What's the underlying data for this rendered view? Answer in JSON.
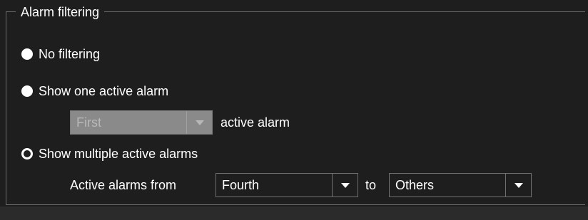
{
  "groupbox": {
    "title": "Alarm filtering"
  },
  "options": {
    "no_filtering": {
      "label": "No filtering",
      "selected": false
    },
    "show_one": {
      "label": "Show one active alarm",
      "selected": false
    },
    "show_multiple": {
      "label": "Show multiple active alarms",
      "selected": true
    }
  },
  "one_alarm": {
    "combo_value": "First",
    "suffix": "active alarm",
    "enabled": false
  },
  "multiple_alarms": {
    "prefix": "Active alarms from",
    "from_value": "Fourth",
    "separator": "to",
    "to_value": "Others"
  },
  "icons": {
    "dropdown": "chevron-down-icon"
  },
  "colors": {
    "background": "#1e1e1e",
    "text": "#ffffff",
    "border": "#707070",
    "disabled_fill": "#8a8a8a"
  }
}
